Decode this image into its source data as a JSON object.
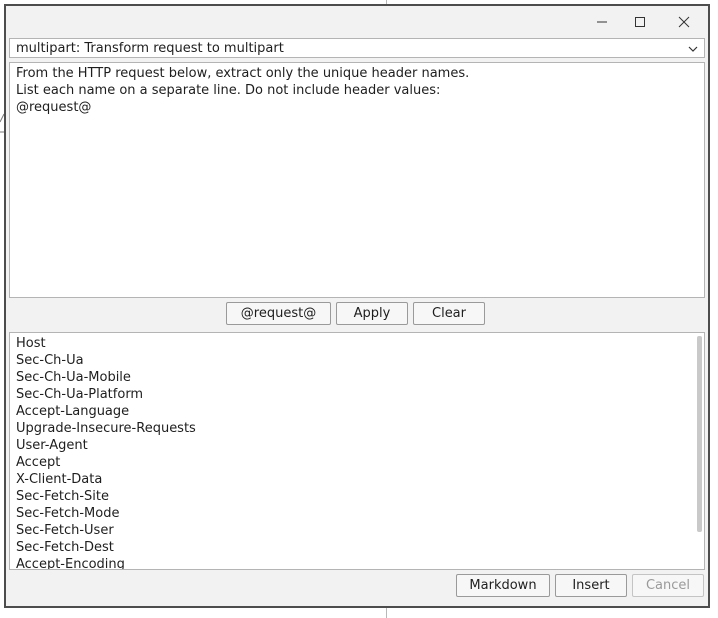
{
  "window": {
    "controls": {
      "minimize_icon": "minimize-icon",
      "maximize_icon": "maximize-icon",
      "close_icon": "close-icon"
    }
  },
  "preset_selector": {
    "selected": "multipart: Transform request to multipart",
    "icon": "chevron-down-icon"
  },
  "prompt": {
    "text": "From the HTTP request below, extract only the unique header names.\nList each name on a separate line. Do not include header values:\n@request@"
  },
  "toolbar": {
    "request_label": "@request@",
    "apply_label": "Apply",
    "clear_label": "Clear"
  },
  "result": {
    "lines": [
      "Host",
      "Sec-Ch-Ua",
      "Sec-Ch-Ua-Mobile",
      "Sec-Ch-Ua-Platform",
      "Accept-Language",
      "Upgrade-Insecure-Requests",
      "User-Agent",
      "Accept",
      "X-Client-Data",
      "Sec-Fetch-Site",
      "Sec-Fetch-Mode",
      "Sec-Fetch-User",
      "Sec-Fetch-Dest",
      "Accept-Encoding"
    ]
  },
  "footer": {
    "markdown_label": "Markdown",
    "insert_label": "Insert",
    "cancel_label": "Cancel"
  }
}
